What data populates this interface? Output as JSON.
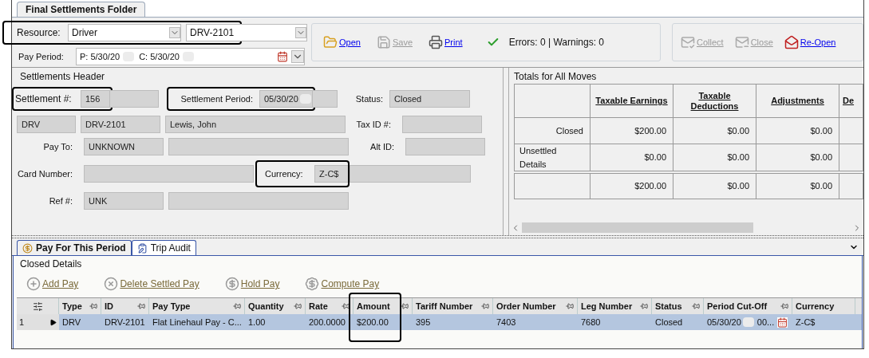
{
  "folder_tab": {
    "label": "Final Settlements Folder",
    "selected": true
  },
  "resource": {
    "label": "Resource:",
    "type": "Driver",
    "id": "DRV-2101"
  },
  "pay_period": {
    "label": "Pay Period:",
    "previous": "P: 5/30/20",
    "current": "C: 5/30/20"
  },
  "toolbar": [
    {
      "kind": "open",
      "label": "Open",
      "disabled": false
    },
    {
      "kind": "save",
      "label": "Save",
      "disabled": true
    },
    {
      "kind": "print",
      "label": "Print",
      "disabled": false
    }
  ],
  "status_message": "Errors: 0 | Warnings: 0",
  "toolbar_2": [
    {
      "kind": "collect",
      "label": "Collect",
      "disabled": true
    },
    {
      "kind": "close",
      "label": "Close",
      "disabled": true
    },
    {
      "kind": "reopen",
      "label": "Re-Open",
      "disabled": false
    }
  ],
  "header": {
    "title": "Settlements Header",
    "settlement_label": "Settlement #:",
    "settlement": "156",
    "period_label": "Settlement Period:",
    "period": "05/30/20",
    "status_label": "Status:",
    "status": "Closed",
    "resource_type": "DRV",
    "resource_id": "DRV-2101",
    "name": "Lewis, John",
    "tax_label": "Tax ID #:",
    "pay_to_label": "Pay To:",
    "pay_to": "UNKNOWN",
    "alt_label": "Alt ID:",
    "card_label": "Card Number:",
    "currency_label": "Currency:",
    "currency": "Z-C$",
    "ref_label": "Ref #:",
    "ref": "UNK"
  },
  "totals": {
    "title": "Totals for All Moves",
    "columns": [
      "Taxable Earnings",
      "Taxable Deductions",
      "Adjustments",
      "De"
    ],
    "rows": [
      {
        "label": "Closed",
        "values": [
          "$200.00",
          "$0.00",
          "$0.00"
        ]
      },
      {
        "label": "Unsettled Details",
        "values": [
          "$0.00",
          "$0.00",
          "$0.00"
        ]
      },
      {
        "label": "",
        "values": [
          "$200.00",
          "$0.00",
          "$0.00"
        ]
      }
    ]
  },
  "lower_tabs": [
    {
      "kind": "pay",
      "label": "Pay For This Period",
      "selected": true
    },
    {
      "kind": "audit",
      "label": "Trip Audit",
      "selected": false
    }
  ],
  "details": {
    "title": "Closed Details",
    "actions": [
      {
        "kind": "add",
        "label": "Add Pay"
      },
      {
        "kind": "delete",
        "label": "Delete Settled Pay"
      },
      {
        "kind": "hold",
        "label": "Hold Pay"
      },
      {
        "kind": "compute",
        "label": "Compute Pay"
      }
    ],
    "columns": [
      "Type",
      "ID",
      "Pay Type",
      "Quantity",
      "Rate",
      "Amount",
      "Tariff Number",
      "Order Number",
      "Leg Number",
      "Status",
      "Period Cut-Off",
      "Currency"
    ],
    "rows": [
      {
        "number": "1",
        "selected": true,
        "cells": [
          "DRV",
          "DRV-2101",
          "Flat Linehaul Pay - C...",
          "1.00",
          "200.0000",
          "$200.00",
          "395",
          "7403",
          "7680",
          "Closed",
          "05/30/20",
          "Z-C$"
        ],
        "cutoff_time": "00..."
      }
    ]
  }
}
